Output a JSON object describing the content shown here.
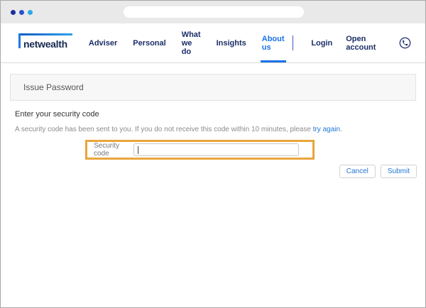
{
  "browser": {
    "dot_colors": [
      "#1d2f9b",
      "#2a52cc",
      "#2ea9e6"
    ],
    "address_value": ""
  },
  "header": {
    "logo_text": "netwealth",
    "nav_items": [
      {
        "label": "Adviser",
        "active": false
      },
      {
        "label": "Personal",
        "active": false
      },
      {
        "label": "What we do",
        "active": false
      },
      {
        "label": "Insights",
        "active": false
      },
      {
        "label": "About us",
        "active": true
      }
    ],
    "login_label": "Login",
    "open_account_label": "Open account",
    "phone_icon": "phone-icon",
    "accent_color": "#1a73e8",
    "nav_text_color": "#1b2d67"
  },
  "banner": {
    "title": "Issue Password"
  },
  "main": {
    "heading": "Enter your security code",
    "message_before_link": "A security code has been sent to you. If you do not receive this code within 10 minutes, please ",
    "message_link": "try again",
    "message_after_link": ".",
    "form": {
      "label": "Security code",
      "value": "",
      "highlight_color": "#e9a53c"
    },
    "actions": {
      "cancel": "Cancel",
      "submit": "Submit"
    }
  }
}
